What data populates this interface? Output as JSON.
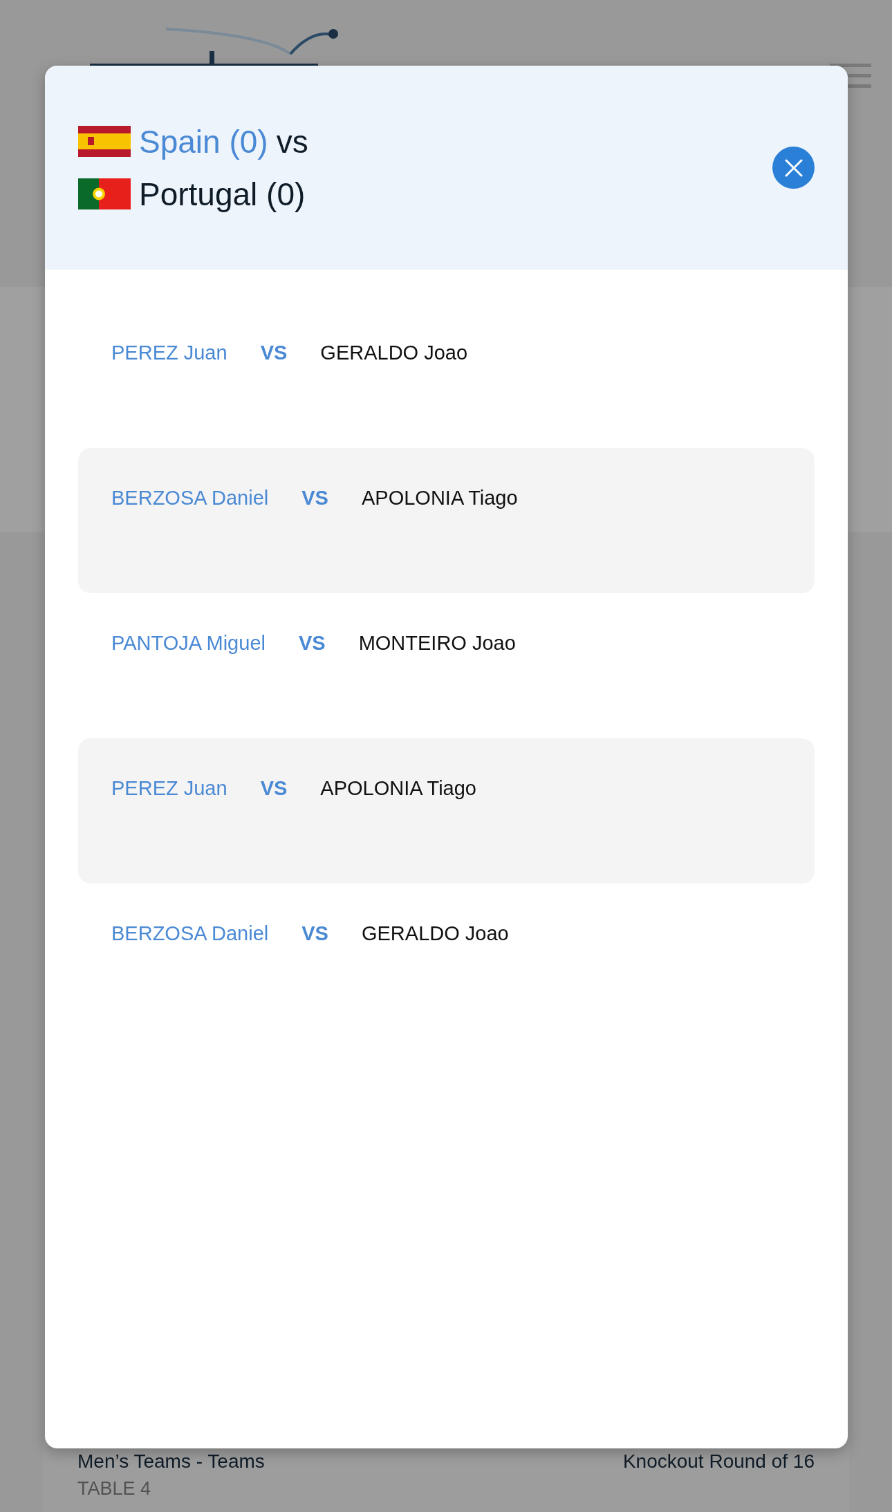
{
  "modal": {
    "teams": [
      {
        "name": "Spain (0)",
        "suffix": "vs",
        "kind": "spain",
        "highlighted": true
      },
      {
        "name": "Portugal (0)",
        "kind": "portugal",
        "highlighted": false
      }
    ],
    "matches": [
      {
        "home": "PEREZ Juan",
        "separator": "VS",
        "away": "GERALDO Joao"
      },
      {
        "home": "BERZOSA Daniel",
        "separator": "VS",
        "away": "APOLONIA Tiago"
      },
      {
        "home": "PANTOJA Miguel",
        "separator": "VS",
        "away": "MONTEIRO Joao"
      },
      {
        "home": "PEREZ Juan",
        "separator": "VS",
        "away": "APOLONIA Tiago"
      },
      {
        "home": "BERZOSA Daniel",
        "separator": "VS",
        "away": "GERALDO Joao"
      }
    ]
  },
  "background": {
    "event": "Men’s Teams - Teams",
    "table": "TABLE 4",
    "round": "Knockout Round of 16"
  }
}
